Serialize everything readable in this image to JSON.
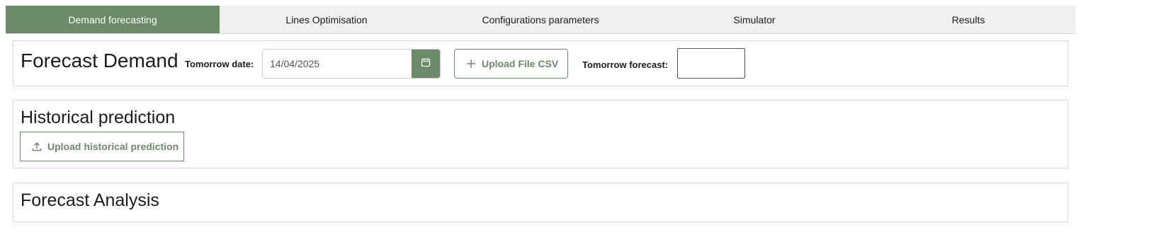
{
  "tabs": [
    {
      "label": "Demand forecasting",
      "active": true
    },
    {
      "label": "Lines Optimisation",
      "active": false
    },
    {
      "label": "Configurations parameters",
      "active": false
    },
    {
      "label": "Simulator",
      "active": false
    },
    {
      "label": "Results",
      "active": false
    }
  ],
  "forecast_demand": {
    "title": "Forecast Demand",
    "tomorrow_date_label": "Tomorrow date:",
    "date_value": "14/04/2025",
    "calendar_icon": "calendar-icon",
    "upload_csv_label": "Upload File CSV",
    "upload_csv_icon": "plus-icon",
    "tomorrow_forecast_label": "Tomorrow forecast:",
    "tomorrow_forecast_value": ""
  },
  "historical_prediction": {
    "title": "Historical prediction",
    "upload_label": "Upload historical prediction",
    "upload_icon": "upload-icon"
  },
  "forecast_analysis": {
    "title": "Forecast Analysis"
  },
  "colors": {
    "accent": "#6b8a68",
    "tab_bg": "#f0f0f0"
  }
}
